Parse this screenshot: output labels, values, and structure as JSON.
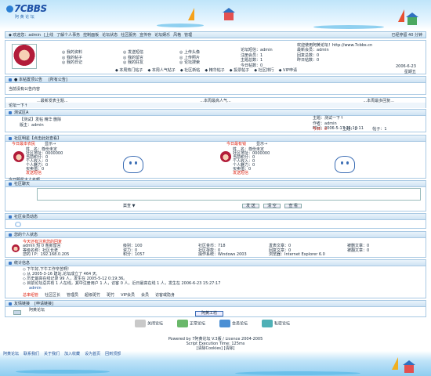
{
  "header": {
    "logo": "7CBBS",
    "logo_sub": "阿 黄 论 坛"
  },
  "navbar": {
    "welcome": "◆ 欢迎您：admin",
    "items": [
      "[上线",
      "了解个人事务",
      "控制面板",
      "论坛状态",
      "社区服务",
      "宣传存",
      "论坛娱乐",
      "风格",
      "管理"
    ],
    "online": "已经停留 40 分钟"
  },
  "usercard": {
    "welcome": "欢迎使用阿黄论坛！http://www.7cbbs.cn",
    "col1": [
      "◎ 我的资料",
      "◎ 我的帖子",
      "◎ 我的日记"
    ],
    "col2": [
      "◎ 发送短信",
      "◎ 我的留言",
      "◎ 我的好友"
    ],
    "col3": [
      "◎ 上传头像",
      "◎ 上传照片",
      "◎ 论坛搜索"
    ],
    "stats": [
      "论坛短信：admin",
      "注册会员：1",
      "主题总数：1",
      "今日帖数：0"
    ],
    "stats2": [
      "",
      "最新会员：admin",
      "回复总数：0",
      "昨日帖数：0"
    ],
    "date": "2006-6-23",
    "weekday": "星期五",
    "links": [
      "◆ 本周热门帖子",
      "◆ 本周人气帖子",
      "◆ 社区新帖",
      "◆ 精华帖子",
      "◆ 投票帖子",
      "◆ 社区排行",
      "◆ VIP申请"
    ]
  },
  "notice": {
    "title": "● 本帖置顶公告",
    "tag": "[所有公告]",
    "body": "当前没有公告内容"
  },
  "hot": {
    "tabs": [
      "...最新发表主题...",
      "...本周最高人气...",
      "...本周最多回复..."
    ],
    "footer": "论坛一下↑"
  },
  "forum": {
    "bar": "论坛一下↑",
    "name": "测试区A",
    "row1": "【测试】发帖 精华 删除",
    "row2": "版主：admin",
    "topic": "主题：测试一下↑",
    "author": "作者：admin",
    "time": "时间：2006-5-17 21:13:11",
    "today": "今日：0",
    "threads": "主题：1",
    "posts": "帖子：1"
  },
  "ads": {
    "bar": "社区明星【点击此处查看】",
    "left_title": "今日最本农民",
    "left_more": "显示→",
    "right_title": "今日最有钱",
    "right_more": "显示→",
    "left_lines": [
      "姓　名：尊份未定",
      "社区地址：0000000",
      "当前积分：0",
      "个人收入：0",
      "个人魅力：0",
      "买卖值：0",
      "发送短信"
    ],
    "right_lines": [
      "姓　名：尊份未定",
      "社区地址：0000000",
      "当前积分：0",
      "个人收入：0",
      "个人魅力：0",
      "买卖值：0",
      "发送短信"
    ],
    "footer": "今日明星大人名额"
  },
  "chat": {
    "bar": "社区聊天",
    "mode": "案查 ▼",
    "send": "发 送",
    "clear": "清 空",
    "view": "查 看"
  },
  "members": {
    "bar": "社区会员动态"
  },
  "personal": {
    "bar": "您的个人状态",
    "note": "今天还有注意您的回复",
    "lines": [
      [
        "admin  短 0 条新留言",
        "级别：100",
        "社区金币：718",
        "发表文章：0",
        "被删文章：0"
      ],
      [
        "等级名称：社区长老",
        "资力：0",
        "社区存款：0",
        "回复文章：0",
        "被翻文章：0"
      ],
      [
        "您的 I P：192.168.0.205",
        "积分：1057",
        "操作系统：Windows 2003",
        "浏览器：Internet Explorer 6.0",
        ""
      ]
    ]
  },
  "stats": {
    "bar": "统计信息",
    "lines": [
      "◇ 下午好,下午工作辛苦啊!",
      "◇ 从 2005-3-16 建站,论坛成立了 464 天,",
      "◇ 历史最高在线记录 99 人，发生在 2005-5-12 0:19:36。",
      "◇ 目前论坛总共有 1 人在线，其中注册用户 1 人，访客 0 人，近日最高在线 1 人，发生在 2006-6-23 15:27:17"
    ],
    "admin_line": "admin",
    "legend": [
      "总率组管",
      "社区区长",
      "管理员",
      "超级斑竹",
      "斑竹",
      "VIP会员",
      "会员",
      "访客或隐身"
    ]
  },
  "friends": {
    "bar": "友情链接",
    "tag": "[申请链接]",
    "name": "阿黄论坛",
    "logo": "阿黄工坊"
  },
  "footer_icons": [
    "关闭论坛",
    "正常论坛",
    "会员论坛",
    "私密论坛"
  ],
  "footer": {
    "powered": "Powered by 7阿黄论坛 V.3版 / Licence 2004-2005",
    "exec": "Script Execution Time: 125ms",
    "links": "[清除Cookies] [清除]"
  },
  "bottom": {
    "links": [
      "阿黄论坛",
      "联系我们",
      "关于我们",
      "加入收藏",
      "设为首页",
      "回到顶部"
    ]
  },
  "colors": {
    "accent": "#1d4f98",
    "bar": "#cfe3f3",
    "red": "#d22222"
  }
}
